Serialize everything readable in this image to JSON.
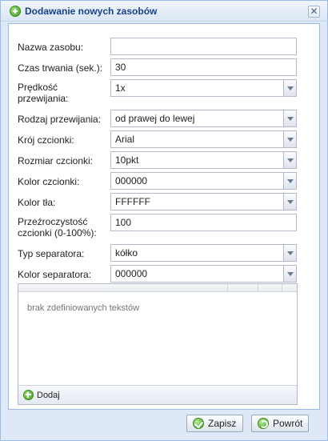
{
  "window": {
    "title": "Dodawanie nowych zasobów",
    "close_glyph": "✕"
  },
  "form": {
    "fields": [
      {
        "label": "Nazwa zasobu:",
        "value": "",
        "type": "text"
      },
      {
        "label": "Czas trwania (sek.):",
        "value": "30",
        "type": "text"
      },
      {
        "label": "Prędkość\nprzewijania:",
        "value": "1x",
        "type": "combo"
      },
      {
        "label": "Rodzaj przewijania:",
        "value": "od prawej do lewej",
        "type": "combo"
      },
      {
        "label": "Krój czcionki:",
        "value": "Arial",
        "type": "combo"
      },
      {
        "label": "Rozmiar czcionki:",
        "value": "10pkt",
        "type": "combo"
      },
      {
        "label": "Kolor czcionki:",
        "value": "000000",
        "type": "combo"
      },
      {
        "label": "Kolor tła:",
        "value": "FFFFFF",
        "type": "combo"
      },
      {
        "label": "Przeźroczystość\nczcionki (0-100%):",
        "value": "100",
        "type": "text"
      },
      {
        "label": "Typ separatora:",
        "value": "kółko",
        "type": "combo"
      },
      {
        "label": "Kolor separatora:",
        "value": "000000",
        "type": "combo"
      }
    ]
  },
  "grid": {
    "empty_text": "brak zdefiniowanych tekstów",
    "add_label": "Dodaj"
  },
  "footer": {
    "save_label": "Zapisz",
    "back_label": "Powrót"
  },
  "icons": {
    "title": "add-circle-icon",
    "close": "close-icon",
    "combo_trigger": "chevron-down-icon",
    "add": "plus-icon",
    "save": "check-icon",
    "back": "undo-icon"
  },
  "colors": {
    "title_text": "#15428b",
    "window_bg": "#dfe8f6",
    "border": "#99bbe8"
  }
}
